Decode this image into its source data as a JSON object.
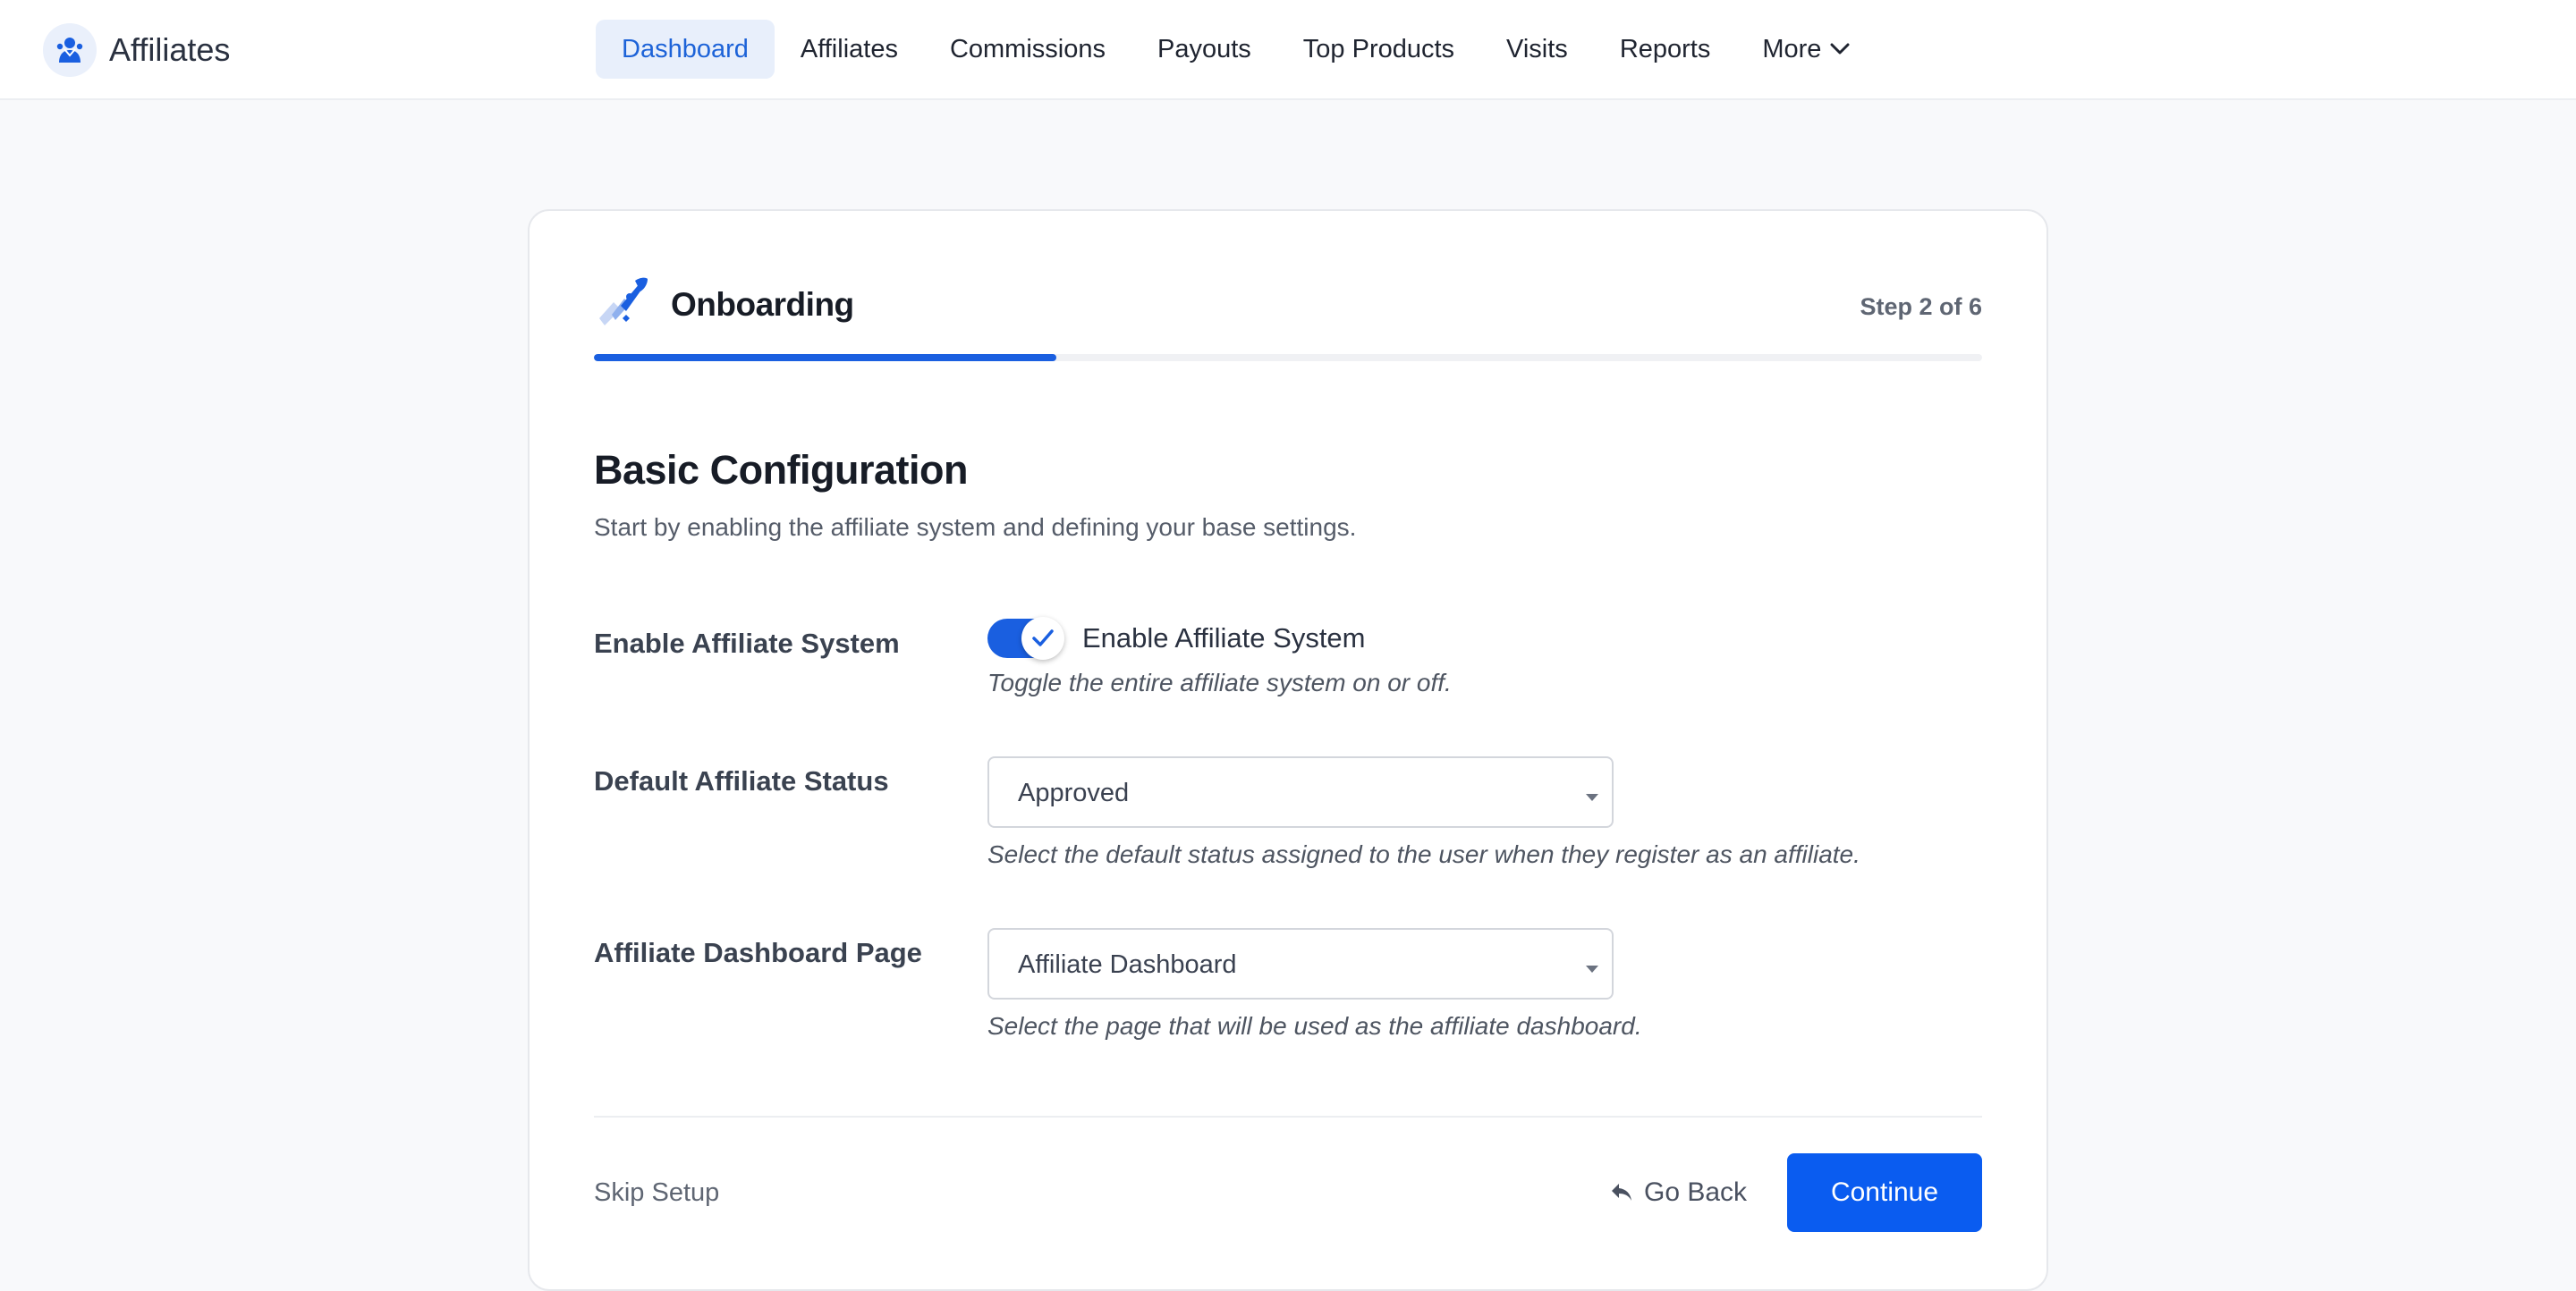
{
  "app": {
    "name": "Affiliates"
  },
  "nav": {
    "items": [
      {
        "label": "Dashboard",
        "active": true
      },
      {
        "label": "Affiliates"
      },
      {
        "label": "Commissions"
      },
      {
        "label": "Payouts"
      },
      {
        "label": "Top Products"
      },
      {
        "label": "Visits"
      },
      {
        "label": "Reports"
      },
      {
        "label": "More",
        "icon": "chevron-down-icon"
      }
    ]
  },
  "onboarding": {
    "title": "Onboarding",
    "step_label": "Step 2 of 6",
    "progress": 0.333,
    "icon": "rocket-icon"
  },
  "section": {
    "title": "Basic Configuration",
    "description": "Start by enabling the affiliate system and defining your base settings."
  },
  "fields": {
    "enable_system": {
      "label": "Enable Affiliate System",
      "toggle_text": "Enable Affiliate System",
      "enabled": true,
      "help": "Toggle the entire affiliate system on or off."
    },
    "default_status": {
      "label": "Default Affiliate Status",
      "value": "Approved",
      "help": "Select the default status assigned to the user when they register as an affiliate."
    },
    "dashboard_page": {
      "label": "Affiliate Dashboard Page",
      "value": "Affiliate Dashboard",
      "help": "Select the page that will be used as the affiliate dashboard."
    }
  },
  "footer": {
    "skip_label": "Skip Setup",
    "back_label": "Go Back",
    "continue_label": "Continue"
  },
  "colors": {
    "accent": "#1a5fe0",
    "button": "#0a5cf0",
    "nav_active_bg": "#e8effb"
  }
}
